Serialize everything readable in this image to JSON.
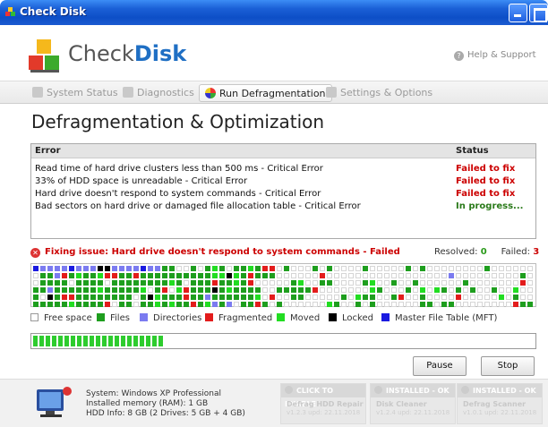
{
  "window": {
    "title": "Check Disk"
  },
  "header": {
    "logo_plain": "Check",
    "logo_bold": "Disk",
    "help_label": "Help & Support"
  },
  "tabs": [
    {
      "label": "System Status"
    },
    {
      "label": "Diagnostics"
    },
    {
      "label": "Run Defragmentation"
    },
    {
      "label": "Settings & Options"
    }
  ],
  "active_tab": "Run Defragmentation",
  "page": {
    "title": "Defragmentation & Optimization"
  },
  "errors": {
    "columns": {
      "error": "Error",
      "status": "Status"
    },
    "rows": [
      {
        "error": "Read time of hard drive clusters less than 500 ms - Critical Error",
        "status": "Failed to fix"
      },
      {
        "error": "33% of HDD space is unreadable - Critical Error",
        "status": "Failed to fix"
      },
      {
        "error": "Hard drive doesn't respond to system commands - Critical Error",
        "status": "Failed to fix"
      },
      {
        "error": "Bad sectors on hard drive or damaged file allocation table - Critical Error",
        "status": "In progress..."
      }
    ]
  },
  "fixing": {
    "text": "Fixing issue: Hard drive doesn't respond to system commands - Failed"
  },
  "counts": {
    "resolved_label": "Resolved:",
    "resolved": "0",
    "failed_label": "Failed:",
    "failed": "3"
  },
  "legend": [
    {
      "label": "Free space",
      "color": "#ffffff"
    },
    {
      "label": "Files",
      "color": "#1e9e1e"
    },
    {
      "label": "Directories",
      "color": "#7b7bf0"
    },
    {
      "label": "Fragmented",
      "color": "#e31c1c"
    },
    {
      "label": "Moved",
      "color": "#22dd22"
    },
    {
      "label": "Locked",
      "color": "#000000"
    },
    {
      "label": "Master File Table (MFT)",
      "color": "#1a1ae0"
    }
  ],
  "progress": {
    "fraction": 0.26
  },
  "buttons": {
    "pause": "Pause",
    "stop": "Stop"
  },
  "system": {
    "os": "System: Windows XP Professional",
    "ram": "Installed memory (RAM): 1 GB",
    "hdd": "HDD Info: 8 GB (2 Drives: 5 GB + 4 GB)"
  },
  "products": [
    {
      "status": "CLICK TO ENABLE",
      "name": "Defrag HDD Repair",
      "version": "v1.2.3 upd: 22.11.2018"
    },
    {
      "status": "INSTALLED - OK",
      "name": "Disk Cleaner",
      "version": "v1.2.4 upd: 22.11.2018"
    },
    {
      "status": "INSTALLED - OK",
      "name": "Defrag Scanner",
      "version": "v1.0.1 upd: 22.11.2018"
    }
  ]
}
